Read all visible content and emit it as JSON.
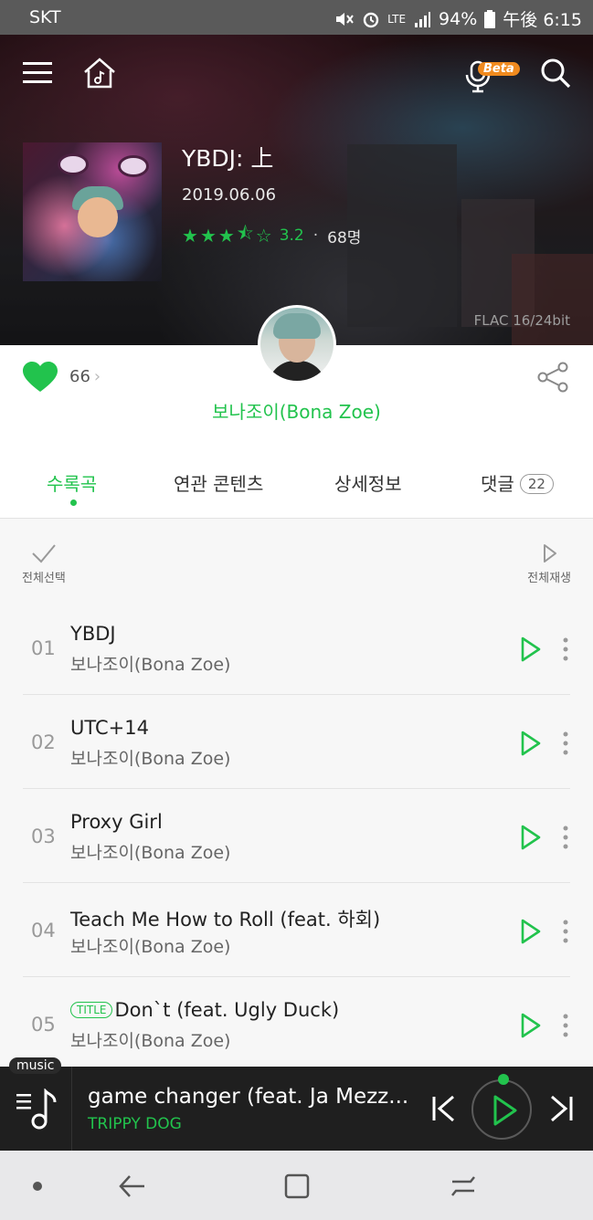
{
  "status_bar": {
    "carrier": "SKT",
    "battery": "94%",
    "time": "午後 6:15",
    "network": "LTE"
  },
  "header": {
    "beta_label": "Beta"
  },
  "album": {
    "title": "YBDJ: 上",
    "release_date": "2019.06.06",
    "rating_score": "3.2",
    "rating_count": "68명",
    "stars_filled": 3.5,
    "quality": "FLAC 16/24bit"
  },
  "info": {
    "likes": "66",
    "artist": "보나조이(Bona Zoe)"
  },
  "tabs": {
    "tracks": "수록곡",
    "related": "연관 콘텐츠",
    "details": "상세정보",
    "comments": "댓글",
    "comments_count": "22"
  },
  "list_controls": {
    "select_all": "전체선택",
    "play_all": "전체재생"
  },
  "tracks": [
    {
      "num": "01",
      "title": "YBDJ",
      "artist": "보나조이(Bona Zoe)"
    },
    {
      "num": "02",
      "title": "UTC+14",
      "artist": "보나조이(Bona Zoe)"
    },
    {
      "num": "03",
      "title": "Proxy Girl",
      "artist": "보나조이(Bona Zoe)"
    },
    {
      "num": "04",
      "title": "Teach Me How to Roll (feat. 하회)",
      "artist": "보나조이(Bona Zoe)"
    },
    {
      "num": "05",
      "title": "Don`t (feat. Ugly Duck)",
      "artist": "보나조이(Bona Zoe)",
      "badge": "TITLE"
    }
  ],
  "player": {
    "tag": "music",
    "song": "game changer (feat. Ja Mezz...",
    "artist": "TRIPPY DOG"
  },
  "colors": {
    "accent": "#22c34d",
    "player_bg": "#1f1f1f",
    "statusbar_bg": "#5a5a5a"
  }
}
